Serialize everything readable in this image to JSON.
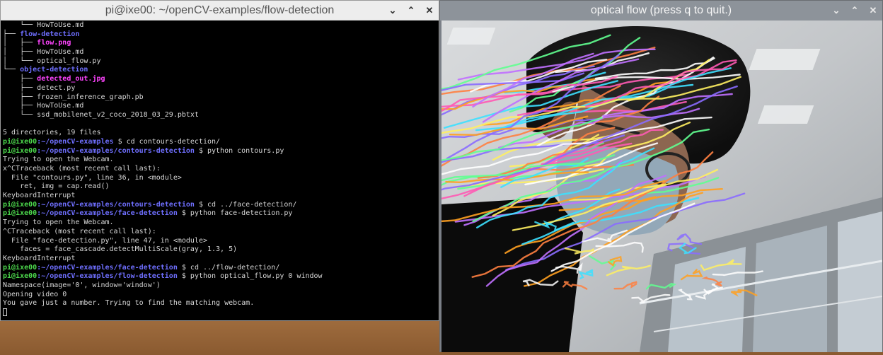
{
  "terminal": {
    "title": "pi@ixe00: ~/openCV-examples/flow-detection",
    "lines": [
      [
        {
          "t": "    └── HowToUse.md",
          "c": ""
        }
      ],
      [
        {
          "t": "├── ",
          "c": ""
        },
        {
          "t": "flow-detection",
          "c": "dir"
        }
      ],
      [
        {
          "t": "│   ├── ",
          "c": ""
        },
        {
          "t": "flow.png",
          "c": "img"
        }
      ],
      [
        {
          "t": "│   ├── HowToUse.md",
          "c": ""
        }
      ],
      [
        {
          "t": "│   └── optical_flow.py",
          "c": ""
        }
      ],
      [
        {
          "t": "└── ",
          "c": ""
        },
        {
          "t": "object-detection",
          "c": "dir"
        }
      ],
      [
        {
          "t": "    ├── ",
          "c": ""
        },
        {
          "t": "detected_out.jpg",
          "c": "img"
        }
      ],
      [
        {
          "t": "    ├── detect.py",
          "c": ""
        }
      ],
      [
        {
          "t": "    ├── frozen_inference_graph.pb",
          "c": ""
        }
      ],
      [
        {
          "t": "    ├── HowToUse.md",
          "c": ""
        }
      ],
      [
        {
          "t": "    └── ssd_mobilenet_v2_coco_2018_03_29.pbtxt",
          "c": ""
        }
      ],
      [
        {
          "t": "",
          "c": ""
        }
      ],
      [
        {
          "t": "5 directories, 19 files",
          "c": ""
        }
      ],
      [
        {
          "t": "pi@ixe00",
          "c": "user"
        },
        {
          "t": ":~/openCV-examples",
          "c": "path"
        },
        {
          "t": " $ cd contours-detection/",
          "c": ""
        }
      ],
      [
        {
          "t": "pi@ixe00",
          "c": "user"
        },
        {
          "t": ":~/openCV-examples/contours-detection",
          "c": "path"
        },
        {
          "t": " $ python contours.py",
          "c": ""
        }
      ],
      [
        {
          "t": "Trying to open the Webcam.",
          "c": ""
        }
      ],
      [
        {
          "t": "x^CTraceback (most recent call last):",
          "c": ""
        }
      ],
      [
        {
          "t": "  File \"contours.py\", line 36, in <module>",
          "c": ""
        }
      ],
      [
        {
          "t": "    ret, img = cap.read()",
          "c": ""
        }
      ],
      [
        {
          "t": "KeyboardInterrupt",
          "c": ""
        }
      ],
      [
        {
          "t": "pi@ixe00",
          "c": "user"
        },
        {
          "t": ":~/openCV-examples/contours-detection",
          "c": "path"
        },
        {
          "t": " $ cd ../face-detection/",
          "c": ""
        }
      ],
      [
        {
          "t": "pi@ixe00",
          "c": "user"
        },
        {
          "t": ":~/openCV-examples/face-detection",
          "c": "path"
        },
        {
          "t": " $ python face-detection.py",
          "c": ""
        }
      ],
      [
        {
          "t": "Trying to open the Webcam.",
          "c": ""
        }
      ],
      [
        {
          "t": "^CTraceback (most recent call last):",
          "c": ""
        }
      ],
      [
        {
          "t": "  File \"face-detection.py\", line 47, in <module>",
          "c": ""
        }
      ],
      [
        {
          "t": "    faces = face_cascade.detectMultiScale(gray, 1.3, 5)",
          "c": ""
        }
      ],
      [
        {
          "t": "KeyboardInterrupt",
          "c": ""
        }
      ],
      [
        {
          "t": "pi@ixe00",
          "c": "user"
        },
        {
          "t": ":~/openCV-examples/face-detection",
          "c": "path"
        },
        {
          "t": " $ cd ../flow-detection/",
          "c": ""
        }
      ],
      [
        {
          "t": "pi@ixe00",
          "c": "user"
        },
        {
          "t": ":~/openCV-examples/flow-detection",
          "c": "path"
        },
        {
          "t": " $ python optical_flow.py 0 window",
          "c": ""
        }
      ],
      [
        {
          "t": "Namespace(image='0', window='window')",
          "c": ""
        }
      ],
      [
        {
          "t": "Opening video 0",
          "c": ""
        }
      ],
      [
        {
          "t": "You gave just a number. Trying to find the matching webcam.",
          "c": ""
        }
      ]
    ],
    "controls": {
      "minimize": "⌄",
      "maximize": "⌃",
      "close": "✕"
    }
  },
  "video_window": {
    "title": "optical flow (press q to quit.)",
    "controls": {
      "minimize": "⌄",
      "maximize": "⌃",
      "close": "✕"
    }
  },
  "colors": {
    "dir": "#6f6fff",
    "img": "#ff44ff",
    "user": "#4cd84c",
    "flow": [
      "#ff5ab4",
      "#ffa020",
      "#3ce0ff",
      "#c070ff",
      "#fff060",
      "#60ff90",
      "#ffffff",
      "#8a6cff",
      "#ff8040"
    ]
  }
}
